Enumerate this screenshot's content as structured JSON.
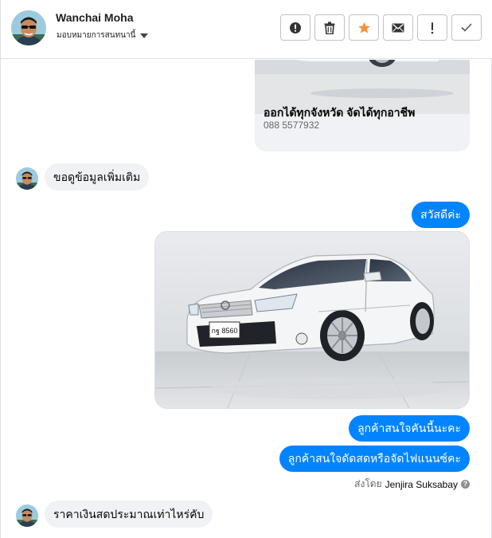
{
  "header": {
    "contact_name": "Wanchai Moha",
    "assign_label": "มอบหมายการสนทนานี้",
    "tools": [
      {
        "name": "report-button",
        "icon": "alert-circle-icon"
      },
      {
        "name": "delete-button",
        "icon": "trash-icon"
      },
      {
        "name": "star-button",
        "icon": "star-icon"
      },
      {
        "name": "mark-unread-button",
        "icon": "envelope-icon"
      },
      {
        "name": "follow-up-button",
        "icon": "exclamation-icon"
      },
      {
        "name": "mark-done-button",
        "icon": "check-icon"
      }
    ]
  },
  "colors": {
    "accent": "#0084ff",
    "bubble_in": "#f0f2f5",
    "star": "#f7923a"
  },
  "messages": {
    "card_title": "ออกได้ทุกจังหวัด จัดได้ทุกอาชีพ",
    "card_phone": "088 5577932",
    "incoming_1": "ขอดูข้อมูลเพิ่มเติม",
    "outgoing_1": "สวัสดีค่ะ",
    "plate_text": "กฐ 8560",
    "outgoing_2": "ลูกค้าสนใจคันนี้นะคะ",
    "outgoing_3": "ลูกค้าสนใจดัดสดหรือจัดไฟแนนซ์คะ",
    "sent_by_prefix": "ส่งโดย",
    "sent_by_name": "Jenjira Suksabay",
    "sent_by_help": "?",
    "incoming_2": "ราคาเงินสดประมาณเท่าไหร่คับ"
  }
}
